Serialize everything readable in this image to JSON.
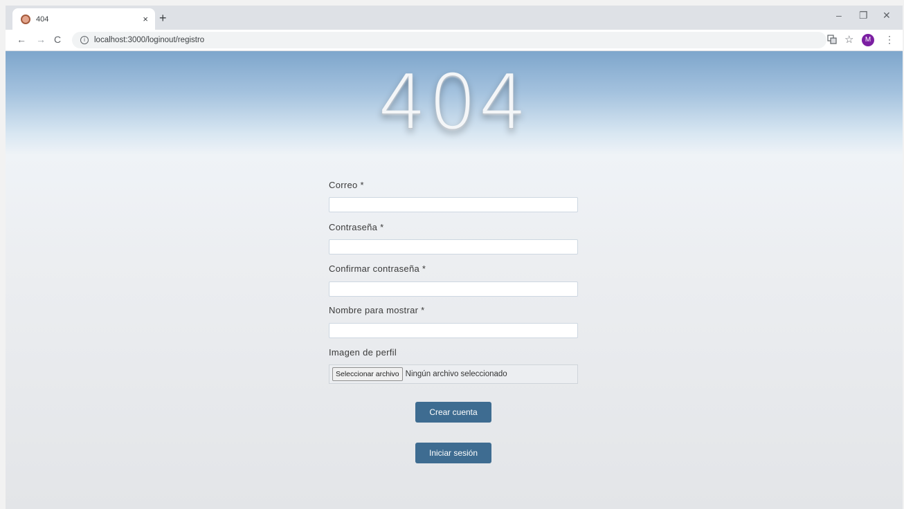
{
  "browser": {
    "tab_title": "404",
    "tab_close": "×",
    "new_tab": "+",
    "back": "←",
    "forward": "→",
    "reload": "C",
    "url": "localhost:3000/loginout/registro",
    "translate_icon": "translate-icon",
    "bookmark_icon": "☆",
    "avatar_letter": "M",
    "menu_icon": "⋮",
    "minimize": "–",
    "maximize": "❐",
    "close": "✕"
  },
  "page": {
    "hero_text": "404",
    "form": {
      "email_label": "Correo *",
      "password_label": "Contraseña *",
      "confirm_label": "Confirmar contraseña *",
      "display_name_label": "Nombre para mostrar *",
      "avatar_label": "Imagen de perfil",
      "file_button": "Seleccionar archivo",
      "file_status": "Ningún archivo seleccionado"
    },
    "create_button": "Crear cuenta",
    "login_button": "Iniciar sesión"
  },
  "colors": {
    "button_bg": "#3e6c91",
    "sky_top": "#7ea6cc",
    "avatar_bg": "#7b1fa2"
  }
}
